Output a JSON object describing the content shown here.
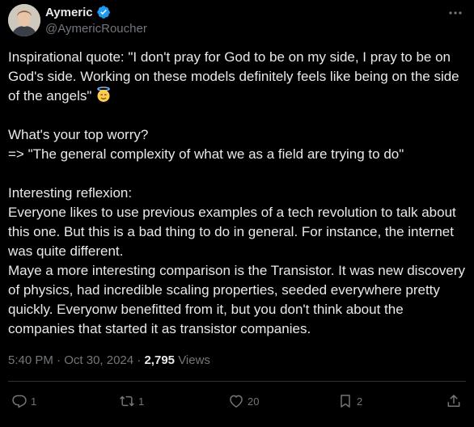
{
  "author": {
    "display_name": "Aymeric",
    "handle": "@AymericRoucher",
    "verified": true
  },
  "tweet": {
    "text_part1": "Inspirational quote: \"I don't pray for God to be on my side, I pray to be on God's side. Working on these models definitely feels like being on the side of the angels\" ",
    "emoji": "angel-face",
    "text_part2": "\n\nWhat's your top worry?\n=> \"The general complexity of what we as a field are trying to do\"\n\nInteresting reflexion:\nEveryone likes to use previous examples of a tech revolution to talk about this one. But this is a bad thing to do in general. For instance, the internet was quite different.\nMaye a more interesting comparison is the Transistor. It was new discovery of physics, had incredible scaling properties, seeded everywhere pretty quickly. Everyonw benefitted from it, but you don't think about the companies that started it as transistor companies."
  },
  "meta": {
    "time": "5:40 PM",
    "separator": "·",
    "date": "Oct 30, 2024",
    "views_count": "2,795",
    "views_label": "Views"
  },
  "actions": {
    "reply_count": "1",
    "repost_count": "1",
    "like_count": "20",
    "bookmark_count": "2"
  },
  "colors": {
    "background": "#000000",
    "text": "#e7e9ea",
    "secondary": "#71767b",
    "verified": "#1d9bf0"
  }
}
